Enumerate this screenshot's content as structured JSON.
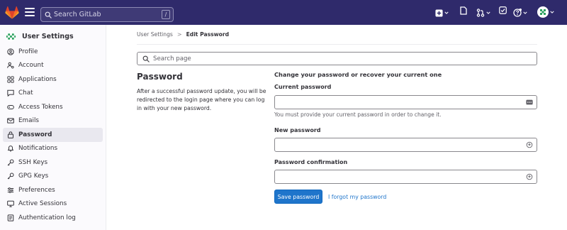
{
  "topbar": {
    "search_placeholder": "Search GitLab",
    "search_shortcut": "/"
  },
  "sidebar": {
    "title": "User Settings",
    "items": [
      {
        "label": "Profile",
        "icon": "profile-icon"
      },
      {
        "label": "Account",
        "icon": "account-icon"
      },
      {
        "label": "Applications",
        "icon": "applications-icon"
      },
      {
        "label": "Chat",
        "icon": "chat-icon"
      },
      {
        "label": "Access Tokens",
        "icon": "token-icon"
      },
      {
        "label": "Emails",
        "icon": "mail-icon"
      },
      {
        "label": "Password",
        "icon": "lock-icon",
        "active": true
      },
      {
        "label": "Notifications",
        "icon": "bell-icon"
      },
      {
        "label": "SSH Keys",
        "icon": "key-icon"
      },
      {
        "label": "GPG Keys",
        "icon": "key-icon"
      },
      {
        "label": "Preferences",
        "icon": "preferences-icon"
      },
      {
        "label": "Active Sessions",
        "icon": "monitor-icon"
      },
      {
        "label": "Authentication log",
        "icon": "log-icon"
      }
    ]
  },
  "breadcrumb": {
    "parent": "User Settings",
    "separator": ">",
    "current": "Edit Password"
  },
  "page_search": {
    "placeholder": "Search page"
  },
  "section": {
    "title": "Password",
    "description": "After a successful password update, you will be redirected to the login page where you can log in with your new password."
  },
  "form": {
    "heading": "Change your password or recover your current one",
    "current_password": {
      "label": "Current password",
      "value": "",
      "help": "You must provide your current password in order to change it."
    },
    "new_password": {
      "label": "New password",
      "value": ""
    },
    "password_confirmation": {
      "label": "Password confirmation",
      "value": ""
    },
    "save_label": "Save password",
    "forgot_label": "I forgot my password"
  },
  "colors": {
    "topbar_bg": "#2f2a6b",
    "primary_button": "#1f75cb",
    "link": "#1f75cb",
    "sidebar_active": "#e9e8ef"
  }
}
